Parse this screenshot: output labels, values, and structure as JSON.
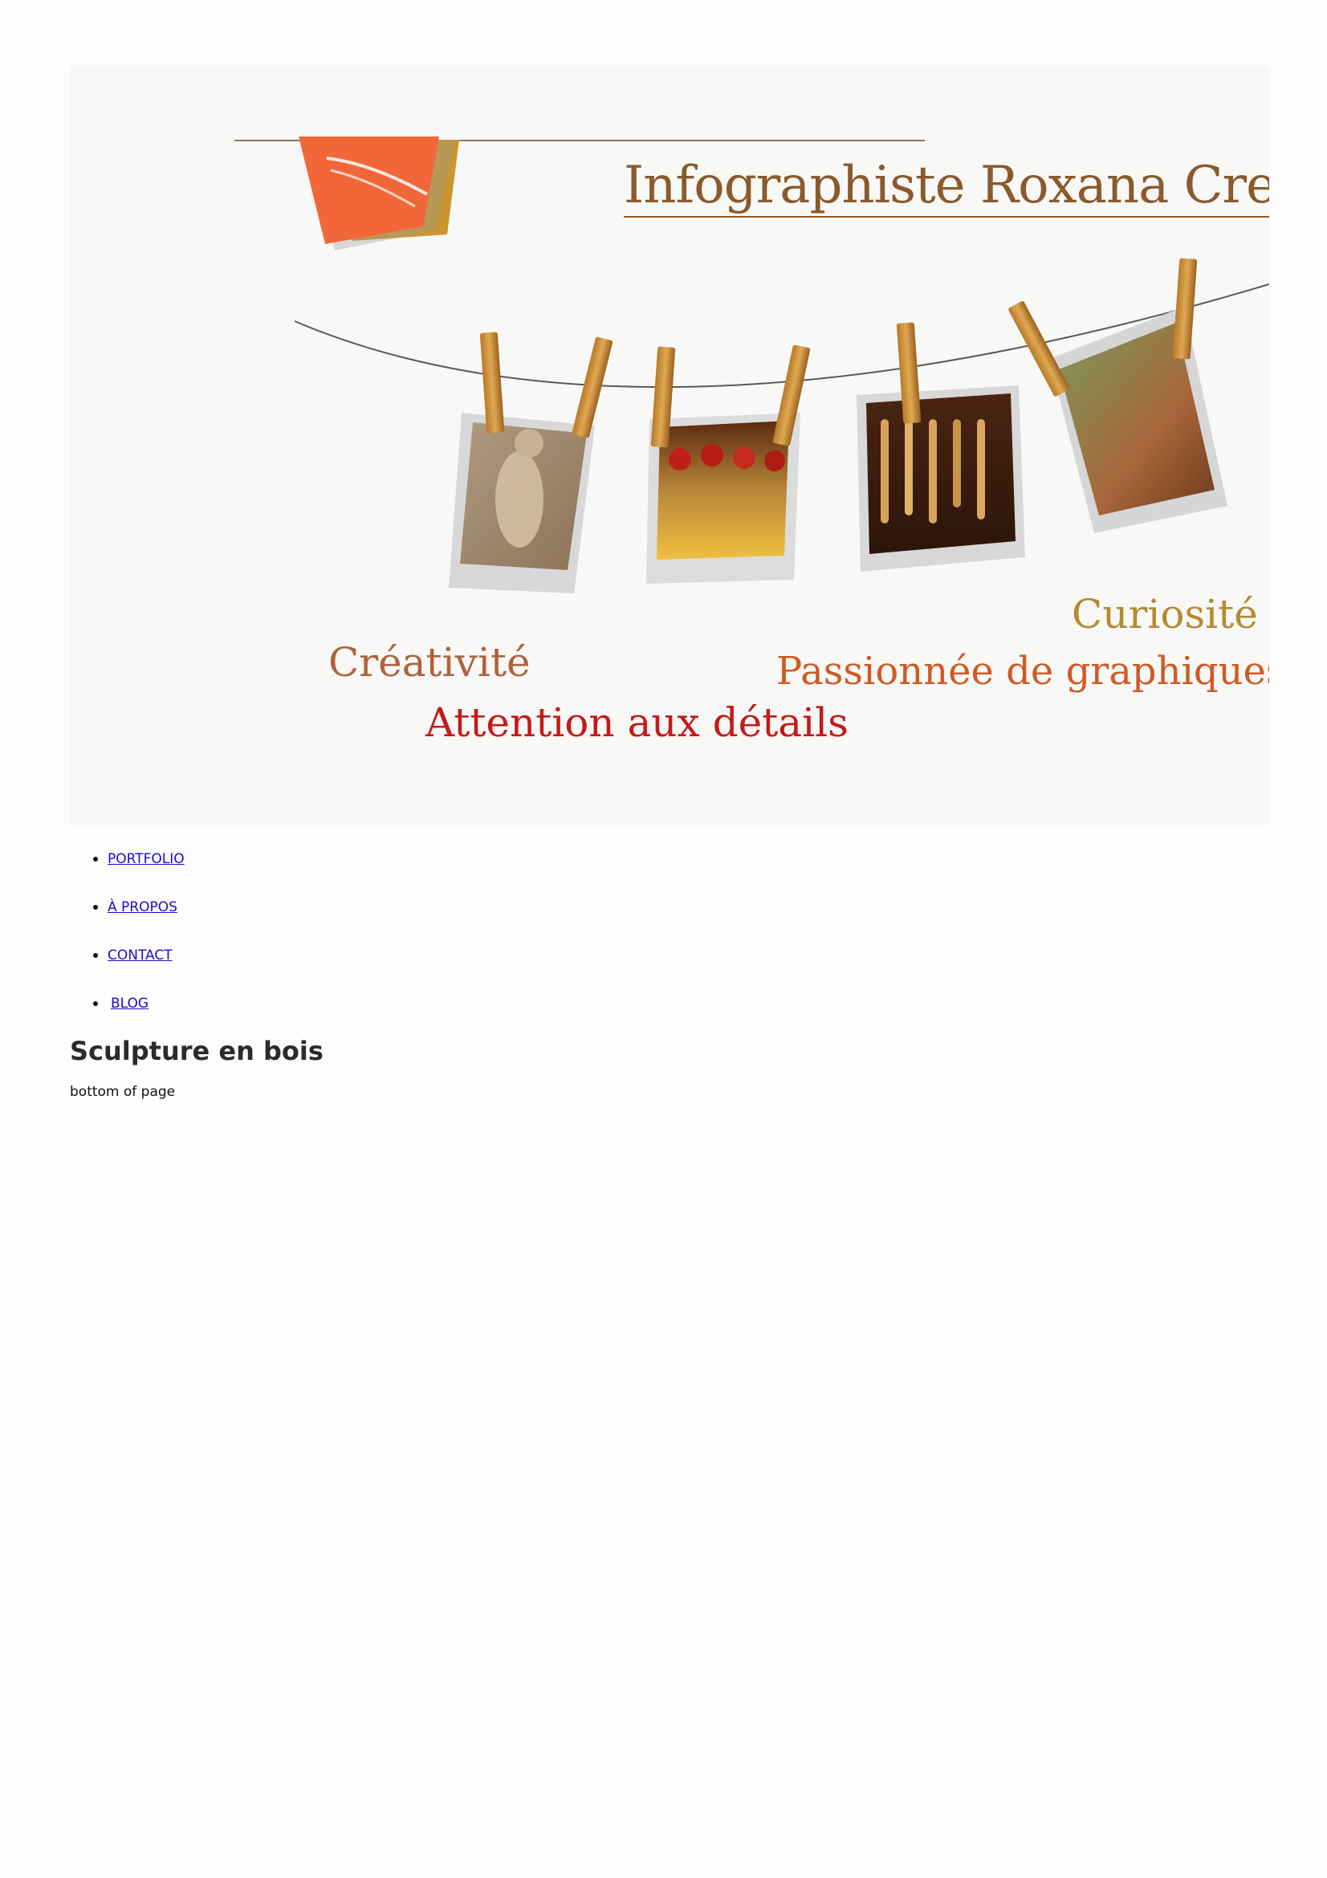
{
  "banner": {
    "title": "Infographiste  Roxana Cretu",
    "tagline_curiosite": "Curiosité",
    "tagline_creativite": "Créativité",
    "tagline_passion": "Passionnée de graphiques",
    "tagline_attention": "Attention aux détails",
    "colors": {
      "title": "#8a5a2c",
      "curiosite": "#b68a2e",
      "creativite": "#b0623a",
      "passion": "#cf5a22",
      "attention": "#c41a1a",
      "logo_orange": "#f2673a",
      "logo_gold": "#c9962f"
    },
    "photos": [
      "owl-carving-photo",
      "fruit-still-life-photo",
      "wooden-spoons-photo",
      "log-cabin-photo"
    ]
  },
  "nav": {
    "items": [
      {
        "label": "PORTFOLIO"
      },
      {
        "label": "À PROPOS"
      },
      {
        "label": "CONTACT"
      },
      {
        "label": "BLOG"
      }
    ],
    "link_color": "#1a0dcc"
  },
  "main": {
    "title": "Sculpture en bois",
    "footer_text": "bottom of page"
  }
}
